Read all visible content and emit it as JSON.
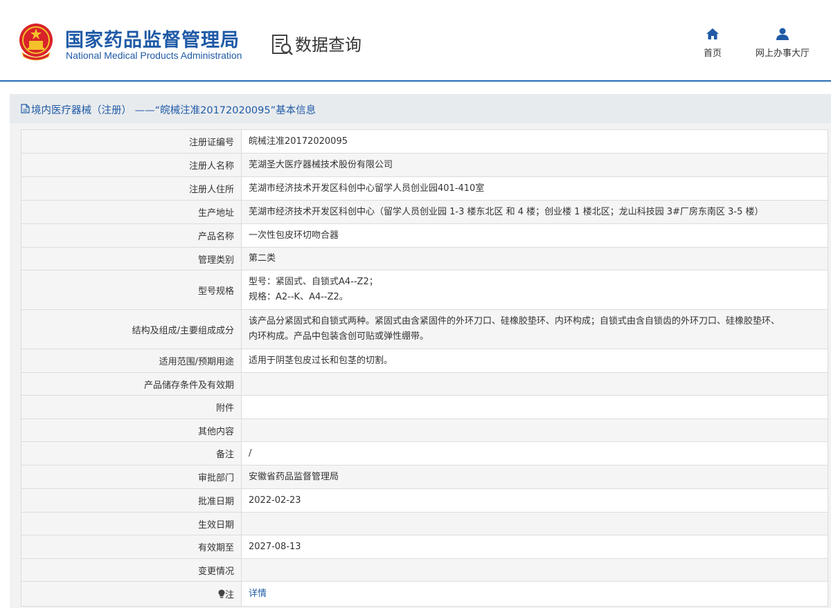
{
  "header": {
    "org_name_cn": "国家药品监督管理局",
    "org_name_en": "National Medical Products Administration",
    "section_title": "数据查询",
    "nav": [
      {
        "label": "首页",
        "icon": "home-icon"
      },
      {
        "label": "网上办事大厅",
        "icon": "user-icon"
      }
    ]
  },
  "colors": {
    "brand_blue": "#1f5aa6",
    "header_rule": "#2a6cb5",
    "label_bg": "#f5f5f5",
    "title_bar_bg": "#e8ebee"
  },
  "page_title": {
    "icon": "document-icon",
    "text": "境内医疗器械（注册） ——“皖械注准20172020095”基本信息"
  },
  "rows": [
    {
      "label": "注册证编号",
      "value": "皖械注准20172020095"
    },
    {
      "label": "注册人名称",
      "value": "芜湖圣大医疗器械技术股份有限公司"
    },
    {
      "label": "注册人住所",
      "value": "芜湖市经济技术开发区科创中心留学人员创业园401-410室"
    },
    {
      "label": "生产地址",
      "value": "芜湖市经济技术开发区科创中心（留学人员创业园 1-3 楼东北区 和 4 楼；创业楼 1 楼北区；龙山科技园 3#厂房东南区 3-5 楼）"
    },
    {
      "label": "产品名称",
      "value": "一次性包皮环切吻合器"
    },
    {
      "label": "管理类别",
      "value": "第二类"
    },
    {
      "label": "型号规格",
      "value_lines": [
        "型号：紧固式、自锁式A4--Z2；",
        "规格：A2--K、A4--Z2。"
      ]
    },
    {
      "label": "结构及组成/主要组成成分",
      "value_lines": [
        "该产品分紧固式和自锁式两种。紧固式由含紧固件的外环刀口、硅橡胶垫环、内环构成；自锁式由含自锁齿的外环刀口、硅橡胶垫环、",
        "内环构成。产品中包装含创可贴或弹性绷带。"
      ]
    },
    {
      "label": "适用范围/预期用途",
      "value": "适用于阴茎包皮过长和包茎的切割。"
    },
    {
      "label": "产品储存条件及有效期",
      "value": ""
    },
    {
      "label": "附件",
      "value": ""
    },
    {
      "label": "其他内容",
      "value": ""
    },
    {
      "label": "备注",
      "value": "/"
    },
    {
      "label": "审批部门",
      "value": "安徽省药品监督管理局"
    },
    {
      "label": "批准日期",
      "value": "2022-02-23"
    },
    {
      "label": "生效日期",
      "value": ""
    },
    {
      "label": "有效期至",
      "value": "2027-08-13"
    },
    {
      "label": "变更情况",
      "value": ""
    },
    {
      "label": "注",
      "label_icon": "lightbulb-icon",
      "value": "详情"
    }
  ]
}
